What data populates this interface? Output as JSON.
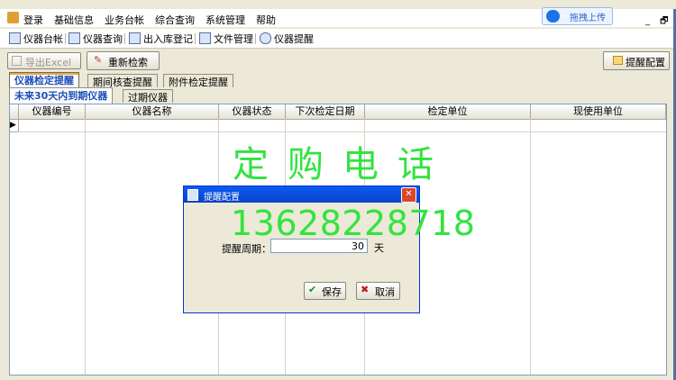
{
  "menu": [
    "登录",
    "基础信息",
    "业务台帐",
    "综合查询",
    "系统管理",
    "帮助"
  ],
  "upload_label": "拖拽上传",
  "window_controls": "_ 🗗",
  "toolbar": [
    {
      "label": "仪器台帐",
      "icon": "ledger-icon"
    },
    {
      "label": "仪器查询",
      "icon": "search-icon"
    },
    {
      "label": "出入库登记",
      "icon": "register-icon"
    },
    {
      "label": "文件管理",
      "icon": "file-icon"
    },
    {
      "label": "仪器提醒",
      "icon": "info-icon"
    }
  ],
  "actions": {
    "export": "导出Excel",
    "reset": "重新检索",
    "remind_config": "提醒配置"
  },
  "tabs": [
    "仪器检定提醒",
    "期间核查提醒",
    "附件检定提醒"
  ],
  "subtabs": [
    "未来30天内到期仪器",
    "过期仪器"
  ],
  "columns": [
    "仪器编号",
    "仪器名称",
    "仪器状态",
    "下次检定日期",
    "检定单位",
    "现使用单位"
  ],
  "row_indicator": "▶",
  "watermark": {
    "title": "定购电话",
    "phone": "13628228718"
  },
  "dialog": {
    "title": "提醒配置",
    "close": "✕",
    "period_label": "提醒周期：",
    "period_value": "30",
    "period_unit": "天",
    "save": "保存",
    "cancel": "取消"
  }
}
